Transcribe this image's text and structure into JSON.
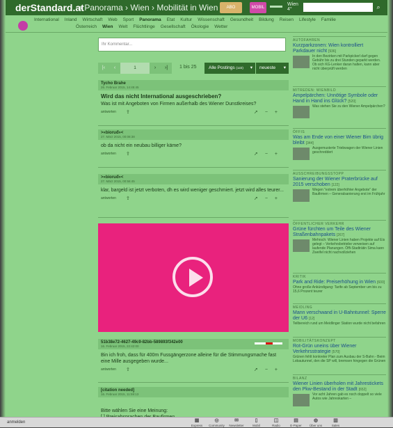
{
  "header": {
    "logo": "derStandard.at",
    "breadcrumb": "› Panorama › Wien › Mobilität in Wien",
    "promo1": "ABO",
    "promo2": "MOBIL",
    "weather_city": "Wien",
    "weather_temp": "4°",
    "search_placeholder": "",
    "search_icon": "search-icon"
  },
  "nav": {
    "row1": [
      "International",
      "Inland",
      "Wirtschaft",
      "Web",
      "Sport",
      "Panorama",
      "Etat",
      "Kultur",
      "Wissenschaft",
      "Gesundheit",
      "Bildung",
      "Reisen",
      "Lifestyle",
      "Familie"
    ],
    "row2": [
      "Österreich",
      "Wien",
      "Welt",
      "Flüchtlinge",
      "Gesellschaft",
      "Ökologie",
      "Wetter"
    ]
  },
  "forum": {
    "comment_placeholder": "Ihr Kommentar...",
    "page_input": "1",
    "page_of": "1 bis 25",
    "filter_label": "Alle Postings",
    "filter_count": "(122)",
    "sort_label": "neueste",
    "reply_label": "antworten"
  },
  "posts": [
    {
      "author": "Tycho Brahe",
      "date": "26. Februar 2015, 14:45:45",
      "title": "Wird das nicht International ausgeschrieben?",
      "text": "Was ist mit Angeboten von Firmen außerhalb des Wiener Dunstkreises?"
    },
    {
      "author": ">«bioruđ»<",
      "date": "27. März 2015, 00:08:38",
      "title": "",
      "text": "ob da nicht ein neubau billiger käme?"
    },
    {
      "author": ">«bioruđ»<",
      "date": "27. März 2015, 00:56:45",
      "title": "",
      "text": "klar, bargeld ist jetzt verboten, dh es wird weniger geschmiert. jetzt wird alles teurer..."
    },
    {
      "author": "51b38e72-4627-49c9-82bb-589893f342e00",
      "date": "16. Februar 2015, 22:42:00",
      "title": "",
      "text": "Bin ich froh, dass für 400m Fussgängerzone alleine für die Stimmungsmache fast eine Mille ausgegeben wurde..."
    },
    {
      "author": "[citation needed]",
      "date": "16. Februar 2015, 11:59:13",
      "title": "",
      "text": "Bitte wählen Sie eine Meinung:\n[ ] Preisabsprachen der Baufirmen"
    }
  ],
  "sidebar": [
    {
      "kicker": "AUTOFAHREN",
      "title": "Kurzparkzonen: Wien kontrolliert Parkdauer nicht",
      "count": "[936]",
      "text": "In den Bezirken mit Parkpickerl darf gegen Gebühr bis zu drei Stunden geparkt werden. Ob sich KG-Lenker daran halten, kann aber nicht überprüft werden"
    },
    {
      "kicker": "MITREDEN: WIENBILD",
      "title": "Ampelpärchen: Unnötige Symbole oder Hand in Hand ins Glück?",
      "count": "[520]",
      "text": "Was stehen Sie zu den Wiener Ampelpärchen?"
    },
    {
      "kicker": "ÖFFIS",
      "title": "Was am Ende von einer Wiener Bim übrig bleibt",
      "count": "[344]",
      "text": "Ausgemusterte Triebwagen der Wiener Linien geschreddert"
    },
    {
      "kicker": "AUSSCHREIBUNGSSTOPP",
      "title": "Sanierung der Wiener Praterbrücke auf 2015 verschoben",
      "count": "[122]",
      "text": "Wegen \"extrem überhöhter Angebote\" der Baufirmen – Generalsanierung erst im Frühjahr"
    },
    {
      "kicker": "ÖFFENTLICHER VERKEHR",
      "title": "Grüne fürchten um Teile des Wiener Straßenbahnpakets",
      "count": "[267]",
      "text": "Mehrsch: Wiener Linien haben Projekte auf Eis gelegt – Verkehrsbetriebe verweisen auf laufende Planungen. Öffi-Stadträtin Sima kann Zweifel nicht nachvollziehen"
    },
    {
      "kicker": "KRITIK",
      "title": "Park and Ride: Preiserhöhung in Wien",
      "count": "[600]",
      "text": "Ohne große Ankündigung: Tarife ab September um bis zu 15,6 Prozent teurer"
    },
    {
      "kicker": "MEIDLING",
      "title": "Mann verschwand in U-Bahntunnel: Sperre der U6",
      "count": "[12]",
      "text": "Teilbereich rund um Meidlinger Station wurde nicht befahren"
    },
    {
      "kicker": "MOBILITÄTSKONZEPT",
      "title": "Rot-Grün uneins über Wiener Verkehrsstrategie",
      "count": "[570]",
      "text": "Grünen fehlt konkreter Plan zum Ausbau der S-Bahn - Beim Lobautunnel, den die SP will, bremsen hingegen die Grünen"
    },
    {
      "kicker": "BILANZ",
      "title": "Wiener Linien überholen mit Jahrestickets den Pkw-Bestand in der Stadt",
      "count": "[652]",
      "text": "Vor acht Jahren gab es noch doppelt so viele Autos wie Jahreskarten –"
    }
  ],
  "footer": {
    "left": "anmelden",
    "items": [
      "Express",
      "Community",
      "Newsletter",
      "Mobil",
      "Radio",
      "E-Paper",
      "Über uns",
      "Sales"
    ]
  },
  "colors": {
    "brand": "#2f6a2b",
    "background": "#8fd48b",
    "video": "#e9227d",
    "link": "#1a4f8a"
  }
}
